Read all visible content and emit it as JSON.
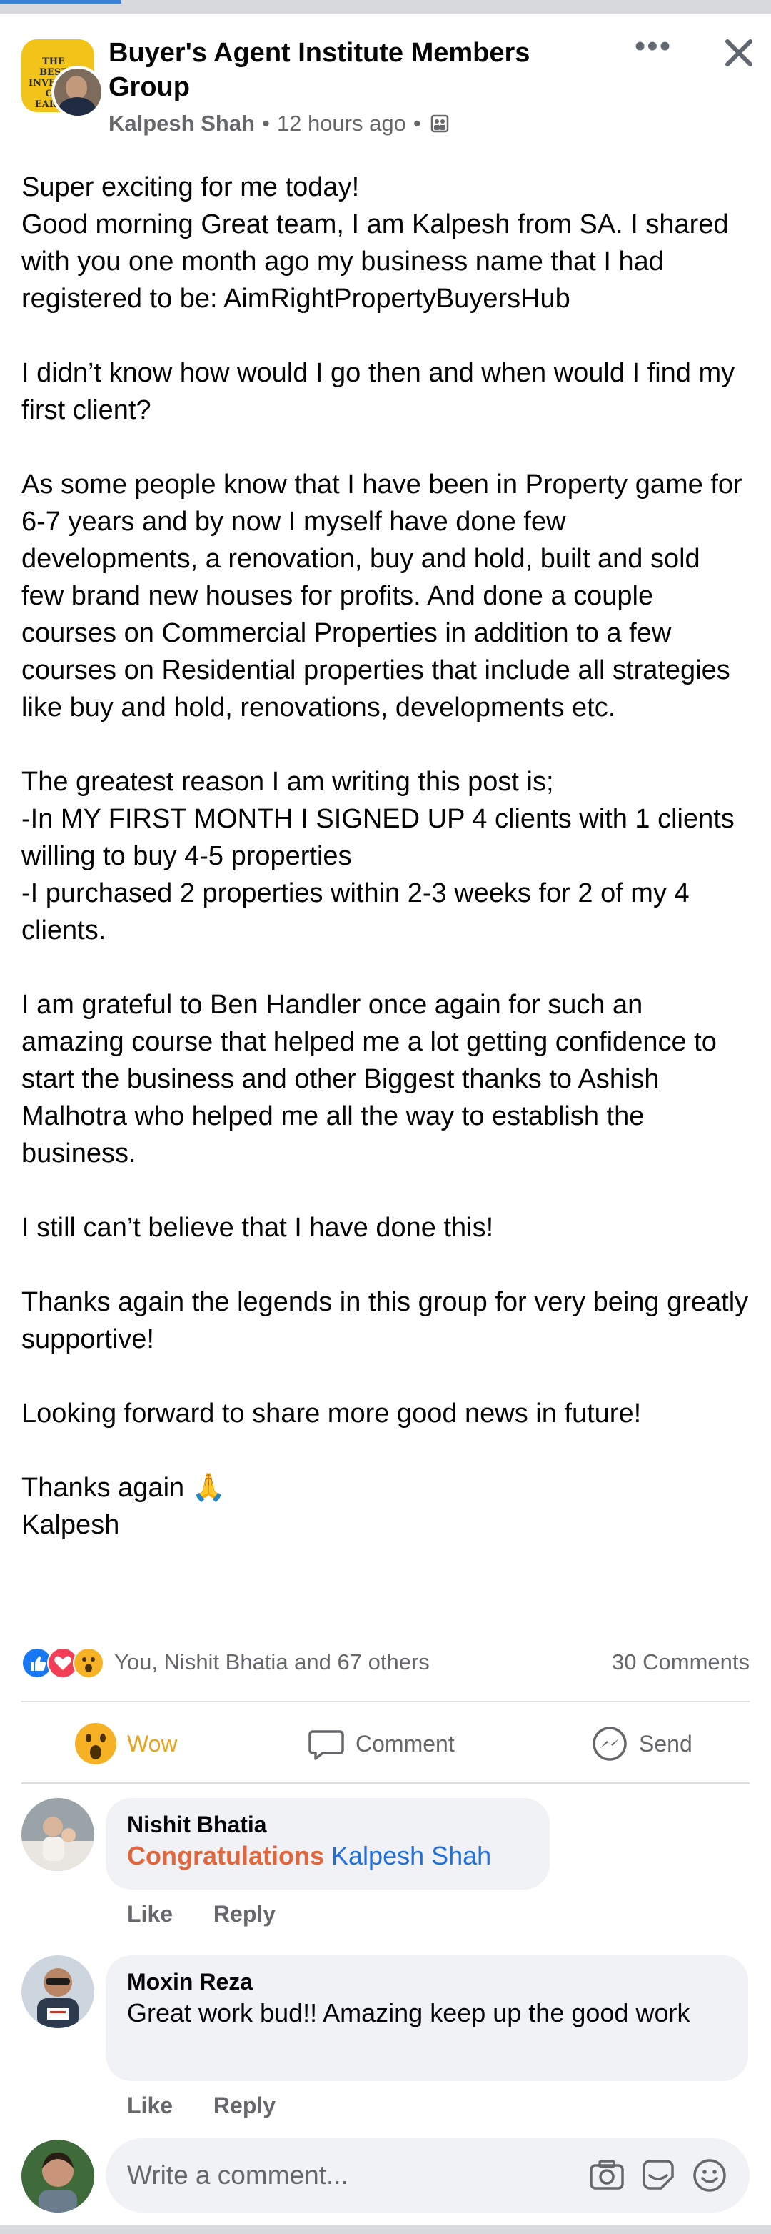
{
  "header": {
    "group_name": "Buyer's Agent Institute Members Group",
    "group_logo_text": "THE BEST INVESTMENT ON EARTH",
    "author": "Kalpesh Shah",
    "time": "12 hours ago",
    "separator": "•",
    "more_label": "•••"
  },
  "post": {
    "text": "Super exciting for me today!\nGood morning Great team, I am Kalpesh from SA. I shared with you one month ago my business name that I had registered to be: AimRightPropertyBuyersHub\n\nI didn’t know how would I go then and when would I find my first client?\n\nAs some people know that I have been in Property game for 6-7 years and by now I myself have done few developments, a renovation, buy and hold, built and sold few brand new houses for profits. And done a couple courses on Commercial Properties in addition to a few courses on Residential properties that include all strategies like buy and hold, renovations, developments etc.\n\nThe greatest reason I am writing this post is;\n-In MY FIRST MONTH I SIGNED UP 4 clients with 1 clients willing to buy 4-5 properties\n-I purchased 2 properties within 2-3 weeks for 2 of my 4 clients.\n\nI am grateful to Ben Handler once again for such an amazing course that helped me a lot getting confidence to start the business and other Biggest thanks to Ashish Malhotra who helped me all the way to establish the business.\n\nI still can’t believe that I have done this!\n\nThanks again the legends in this group for very being greatly supportive!\n\nLooking forward to share more good news in future!\n\nThanks again 🙏\nKalpesh"
  },
  "reactions": {
    "summary": "You, Nishit Bhatia and 67 others",
    "comments_count": "30 Comments",
    "icons": [
      "like-icon",
      "love-icon",
      "wow-icon"
    ]
  },
  "actions": {
    "wow": "Wow",
    "comment": "Comment",
    "send": "Send"
  },
  "comments": [
    {
      "name": "Nishit Bhatia",
      "text_highlight": "Congratulations",
      "text_mention": "Kalpesh Shah",
      "like": "Like",
      "reply": "Reply"
    },
    {
      "name": "Moxin Reza",
      "text": "Great work bud!! Amazing keep up the good work",
      "like": "Like",
      "reply": "Reply"
    }
  ],
  "composer": {
    "placeholder": "Write a comment..."
  },
  "colors": {
    "brand_blue": "#1877f2",
    "wow_yellow": "#f7b125",
    "love_red": "#f33e58",
    "highlight_orange": "#e0663e",
    "mention_blue": "#216fdb",
    "secondary_text": "#65676b",
    "bubble_bg": "#f0f2f5"
  }
}
